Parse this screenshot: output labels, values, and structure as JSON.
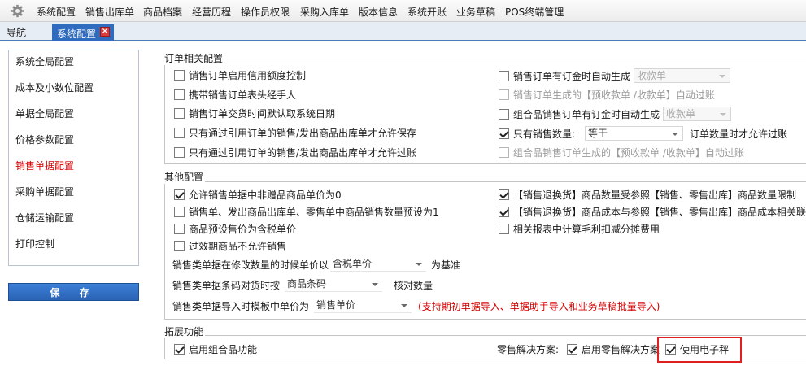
{
  "menu": {
    "items": [
      "系统配置",
      "销售出库单",
      "商品档案",
      "经营历程",
      "操作员权限",
      "采购入库单",
      "版本信息",
      "系统开账",
      "业务草稿",
      "POS终端管理"
    ]
  },
  "tabs": {
    "nav_label": "导航",
    "active_label": "系统配置"
  },
  "sidebar": {
    "items": [
      "系统全局配置",
      "成本及小数位配置",
      "单据全局配置",
      "价格参数配置",
      "销售单据配置",
      "采购单据配置",
      "仓储运输配置",
      "打印控制"
    ],
    "active_index": 4,
    "save_label": "保 存"
  },
  "order_section": {
    "title": "订单相关配置",
    "left": [
      {
        "label": "销售订单启用信用额度控制",
        "checked": false
      },
      {
        "label": "携带销售订单表头经手人",
        "checked": false
      },
      {
        "label": "销售订单交货时间默认取系统日期",
        "checked": false
      },
      {
        "label": "只有通过引用订单的销售/发出商品出库单才允许保存",
        "checked": false
      },
      {
        "label": "只有通过引用订单的销售/发出商品出库单才允许过账",
        "checked": false
      }
    ],
    "right": {
      "auto_gen_label": "销售订单有订金时自动生成",
      "auto_gen_value": "收款单",
      "prepay_label": "销售订单生成的【预收款单 /收款单】自动过账",
      "combo_auto_label": "组合品销售订单有订金时自动生成",
      "combo_auto_value": "收款单",
      "qty_label": "只有销售数量:",
      "qty_value": "等于",
      "qty_suffix": "订单数量时才允许过账",
      "combo_prepay_label": "组合品销售订单生成的【预收款单 /收款单】自动过账"
    }
  },
  "other_section": {
    "title": "其他配置",
    "left": [
      {
        "label": "允许销售单据中非赠品商品单价为0",
        "checked": true
      },
      {
        "label": "销售单、发出商品出库单、零售单中商品销售数量预设为1",
        "checked": false
      },
      {
        "label": "商品预设售价为含税单价",
        "checked": false
      },
      {
        "label": "过效期商品不允许销售",
        "checked": false
      }
    ],
    "right": [
      {
        "label": "【销售退换货】商品数量受参照【销售、零售出库】商品数量限制",
        "checked": true
      },
      {
        "label": "【销售退换货】商品成本与参照【销售、零售出库】商品成本相关联",
        "checked": true
      },
      {
        "label": "相关报表中计算毛利扣减分摊费用",
        "checked": false
      }
    ],
    "price_row": {
      "prefix": "销售类单据在修改数量的时候单价以",
      "value": "含税单价",
      "suffix": "为基准"
    },
    "barcode_row": {
      "prefix": "销售类单据条码对货时按",
      "value": "商品条码",
      "suffix": "核对数量"
    },
    "import_row": {
      "prefix": "销售类单据导入时模板中单价为",
      "value": "销售单价",
      "note": "(支持期初单据导入、单据助手导入和业务草稿批量导入)"
    }
  },
  "ext_section": {
    "title": "拓展功能",
    "combo_label": "启用组合品功能",
    "combo_checked": true,
    "retail_prefix": "零售解决方案:",
    "retail_label": "启用零售解决方案",
    "retail_checked": true,
    "scale_label": "使用电子秤",
    "scale_checked": true
  }
}
